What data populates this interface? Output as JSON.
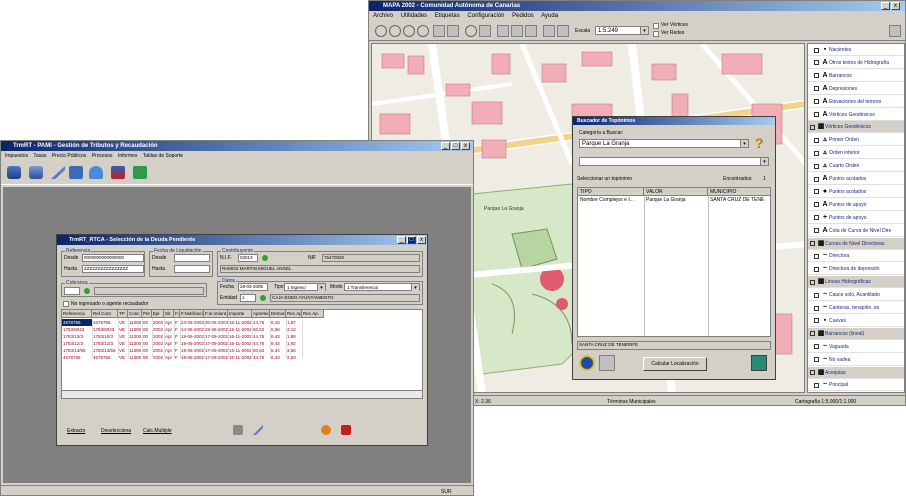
{
  "map_window": {
    "title": "MAPA 2002 - Comunidad Autónoma de Canarias",
    "menu": [
      "Archivo",
      "Utilidades",
      "Etiquetas",
      "Configuración",
      "Pedidos",
      "Ayuda"
    ],
    "scale_label": "Escala",
    "scale_value": "1:5.249",
    "check_vertices": "Ver Vértices",
    "check_redes": "Ver Redes",
    "map_labels": [
      "Parque La Granja"
    ],
    "layers": [
      {
        "label": "Nacientes",
        "symbol": "▪",
        "group": false
      },
      {
        "label": "Otros textos de Hidrografía",
        "symbol": "A",
        "group": false
      },
      {
        "label": "Barrancos",
        "symbol": "A",
        "group": false
      },
      {
        "label": "Depresiones",
        "symbol": "A",
        "group": false
      },
      {
        "label": "Elevaciones del terreno",
        "symbol": "A",
        "group": false
      },
      {
        "label": "Vértices Geodésicos",
        "symbol": "A",
        "group": false
      },
      {
        "label": "Vértices Geodésicos",
        "symbol": "▦",
        "group": true
      },
      {
        "label": "Primer Orden",
        "symbol": "▵",
        "group": false
      },
      {
        "label": "Orden inferior",
        "symbol": "▵",
        "group": false
      },
      {
        "label": "Cuarto Orden",
        "symbol": "▵",
        "group": false
      },
      {
        "label": "Puntos acotados",
        "symbol": "A",
        "group": false
      },
      {
        "label": "Puntos acotados",
        "symbol": "●",
        "group": false
      },
      {
        "label": "Puntos de apoyo",
        "symbol": "A",
        "group": false
      },
      {
        "label": "Puntos de apoyo",
        "symbol": "+",
        "group": false
      },
      {
        "label": "Cota de Curva de Nivel Dire",
        "symbol": "A",
        "group": false
      },
      {
        "label": "Curvas de Nivel Directoras",
        "symbol": "▦",
        "group": true
      },
      {
        "label": "Directora",
        "symbol": "~",
        "group": false
      },
      {
        "label": "Directora de depresión",
        "symbol": "~",
        "group": false
      },
      {
        "label": "Líneas Hidrográficas",
        "symbol": "▦",
        "group": true
      },
      {
        "label": "Cauce solo, Acantilado",
        "symbol": "~",
        "group": false
      },
      {
        "label": "Canteras, tenaplén, es",
        "symbol": "~",
        "group": false
      },
      {
        "label": "Cuevas",
        "symbol": "▪",
        "group": false
      },
      {
        "label": "Barrancos (lineal)",
        "symbol": "▦",
        "group": true
      },
      {
        "label": "Vaguada",
        "symbol": "~",
        "group": false
      },
      {
        "label": "No vadea",
        "symbol": "~",
        "group": false
      },
      {
        "label": "Acequias",
        "symbol": "▦",
        "group": true
      },
      {
        "label": "Principal",
        "symbol": "~",
        "group": false
      }
    ],
    "status": {
      "coord": "X: 2.36",
      "layer_name": "Términos Municipales",
      "cartography": "Cartografía 1:5.000/1:1.000"
    }
  },
  "buscador": {
    "title": "Buscador de Topónimos",
    "category_label": "Categoría a Buscar:",
    "category_value": "Parque La Granja",
    "select_label": "Seleccionar un topónimo",
    "found_label": "Encontrados:",
    "found_count": "1",
    "columns": [
      "TIPO",
      "VALOR",
      "MUNICIPIO"
    ],
    "rows": [
      [
        "Nombre Complejos e I...",
        "Parque La Granja",
        "SANTA CRUZ DE TENE"
      ]
    ],
    "footer_value": "SANTA CRUZ DE TENERIFE",
    "calc_button": "Calcular Localización"
  },
  "trib_window": {
    "title": "TrmRT - PAMI - Gestión de Tributos y Recaudación",
    "menu": [
      "Impuestos",
      "Tasas",
      "Precio Públicos",
      "Procesos",
      "Informes",
      "Tablas de Soporte"
    ],
    "status_right": "SUR"
  },
  "sel_dialog": {
    "title": "TrmRT_RTCA - Selección de la Deuda Pendiente",
    "referencia_group": "Referencia",
    "desde_label": "Desde",
    "hasta_label": "Hasta",
    "desde_value": "0000000000000000",
    "hasta_value": "ZZZZZZZZZZZZZZZZ",
    "fecha_liq_group": "Fecha de Liquidación",
    "fdesde_label": "Desde",
    "fhasta_label": "Hasta",
    "contrib_group": "Contribuyente",
    "nif_label": "NIF",
    "contrib_code": "02013",
    "nif_value": "75470020",
    "contrib_name": "RAMOS MARTIN MIGUEL ANGEL",
    "cobranza_group": "Cobranza",
    "no_ingresado_label": "No ingresado o agente recaudador",
    "datos_group": "Datos",
    "fecha_label": "Fecha",
    "fecha_value": "28-03-2005",
    "tipo_label": "Tipo",
    "tipo_value": "1 Ingreso",
    "modo_label": "Modo",
    "modo_value": "1 Transferencia",
    "entidad_label": "Entidad",
    "entidad_code": "1",
    "entidad_name": "CAJA ENDO AYUNTAMIENTO",
    "columns": [
      "Referencia",
      "Ref.Cont",
      "TP",
      "Conc",
      "Per",
      "Eje",
      "Sit",
      "F.Liquidación",
      "F.Notificación",
      "F.In.Volunt.",
      "Importe",
      "Apremio",
      "Demora",
      "Rec.Apremio",
      "Rec.Ap."
    ],
    "rows": [
      [
        "4678765",
        "4678765",
        "VE",
        "11300",
        "00",
        "2003",
        "Apr",
        "F",
        "23-06-2003",
        "30-06-2003",
        "16-11-2002",
        "44,75",
        "8,43",
        "1,87"
      ],
      [
        "1783/8043",
        "1783/8043",
        "VE",
        "11300",
        "00",
        "2002",
        "Apr",
        "F",
        "24-06-2002",
        "26-06-2002",
        "16-11-2002",
        "50,62",
        "5,36",
        "3,12"
      ],
      [
        "1783/10/3",
        "1783/10/3",
        "VE",
        "11300",
        "00",
        "2002",
        "Apr",
        "F",
        "19-06-2002",
        "17-09-2002",
        "16-11-2002",
        "44,75",
        "8,43",
        "1,88"
      ],
      [
        "1783/12/3",
        "1783/12/3",
        "VE",
        "11300",
        "00",
        "2002",
        "Apr",
        "F",
        "19-06-2002",
        "17-09-2002",
        "16-11-2002",
        "44,75",
        "8,43",
        "1,92"
      ],
      [
        "1783/13/65",
        "1783/13/65",
        "VE",
        "11300",
        "00",
        "2002",
        "Apr",
        "F",
        "19-06-2002",
        "17-09-2002",
        "16-11-2002",
        "50,62",
        "5,34",
        "3,56"
      ],
      [
        "4678765",
        "4678765",
        "VE",
        "11300",
        "00",
        "2002",
        "Apr",
        "F",
        "19-06-2002",
        "17-09-2002",
        "16-11-2002",
        "44,75",
        "8,43",
        "2,63"
      ]
    ],
    "footer_links": [
      "Extracto",
      "Deselecciona",
      "Calc.Multiple"
    ]
  }
}
